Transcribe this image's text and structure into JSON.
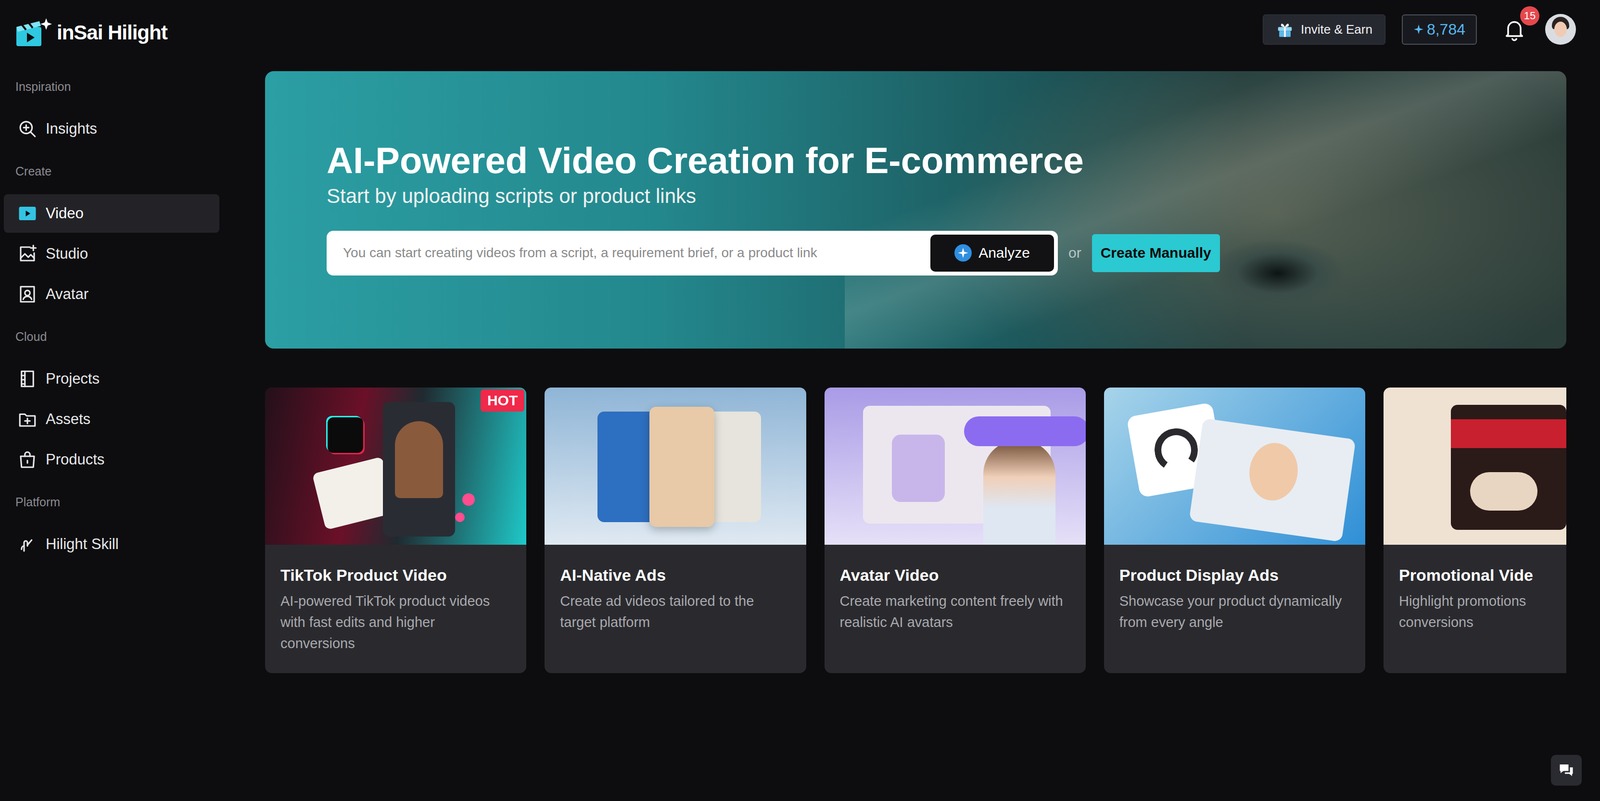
{
  "app": {
    "logo": "inSai Hilight"
  },
  "sidebar": {
    "sections": [
      {
        "label": "Inspiration",
        "items": [
          {
            "label": "Insights",
            "selected": false
          }
        ]
      },
      {
        "label": "Create",
        "items": [
          {
            "label": "Video",
            "selected": true
          },
          {
            "label": "Studio",
            "selected": false
          },
          {
            "label": "Avatar",
            "selected": false
          }
        ]
      },
      {
        "label": "Cloud",
        "items": [
          {
            "label": "Projects",
            "selected": false
          },
          {
            "label": "Assets",
            "selected": false
          },
          {
            "label": "Products",
            "selected": false
          }
        ]
      },
      {
        "label": "Platform",
        "items": [
          {
            "label": "Hilight Skill",
            "selected": false
          }
        ]
      }
    ]
  },
  "topbar": {
    "invite": "Invite & Earn",
    "credits": "8,784",
    "notifications": "15"
  },
  "hero": {
    "title": "AI-Powered Video Creation for E-commerce",
    "subtitle": "Start by uploading scripts or product links",
    "placeholder": "You can start creating videos from a script, a requirement brief, or a product link",
    "analyze": "Analyze",
    "or": "or",
    "create": "Create Manually"
  },
  "cards": [
    {
      "title": "TikTok Product Video",
      "desc": "AI-powered TikTok product videos with fast edits and higher conversions",
      "badge": "HOT"
    },
    {
      "title": "AI-Native Ads",
      "desc": "Create ad videos tailored to the target platform"
    },
    {
      "title": "Avatar Video",
      "desc": "Create marketing content freely with realistic AI avatars"
    },
    {
      "title": "Product Display Ads",
      "desc": "Showcase your product dynamically from every angle"
    },
    {
      "title": "Promotional Vide",
      "desc": "Highlight promotions conversions"
    }
  ]
}
